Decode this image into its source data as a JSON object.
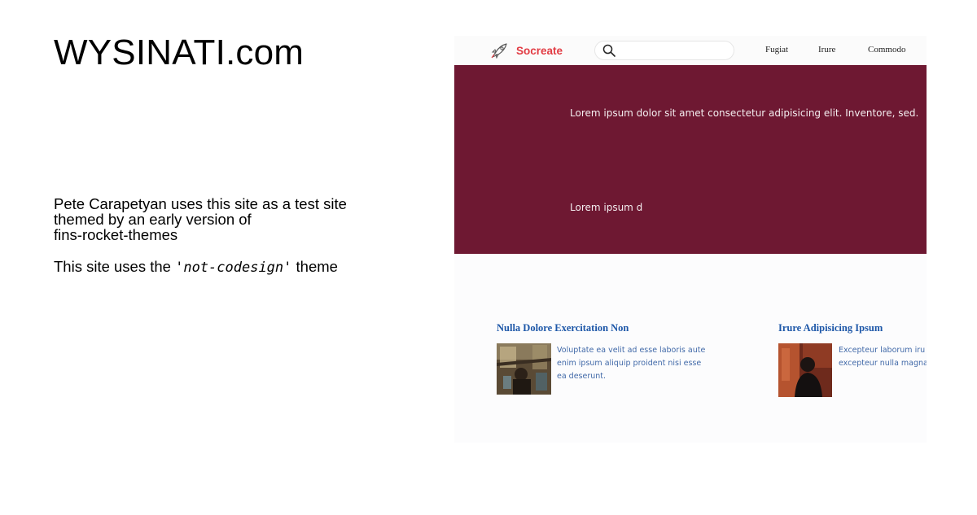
{
  "site": {
    "title": "WYSINATI.com"
  },
  "intro": {
    "line1": "Pete Carapetyan uses this site as a test site",
    "line2": "themed by an early version of",
    "line3": "fins-rocket-themes",
    "theme_prefix": "This site uses the ",
    "theme_name": "'not-codesign'",
    "theme_suffix": " theme"
  },
  "preview": {
    "brand": {
      "name": "Socreate",
      "icon": "rocket-icon",
      "color": "#e23b43"
    },
    "search": {
      "icon": "search-icon",
      "placeholder": ""
    },
    "nav": [
      {
        "label": "Fugiat"
      },
      {
        "label": "Irure"
      },
      {
        "label": "Commodo"
      }
    ],
    "hero": {
      "background": "#6e1832",
      "headline": "Lorem ipsum dolor sit amet consectetur adipisicing elit. Inventore, sed.",
      "subline": "Lorem ipsum d"
    },
    "cards": [
      {
        "title": "Nulla Dolore Exercitation Non",
        "text_lines": [
          "Voluptate ea velit ad esse laboris aute",
          "enim ipsum aliquip proident nisi esse",
          "ea deserunt."
        ]
      },
      {
        "title": "Irure Adipisicing Ipsum",
        "text_lines": [
          "Excepteur laborum iru",
          "excepteur nulla magna"
        ]
      }
    ]
  }
}
